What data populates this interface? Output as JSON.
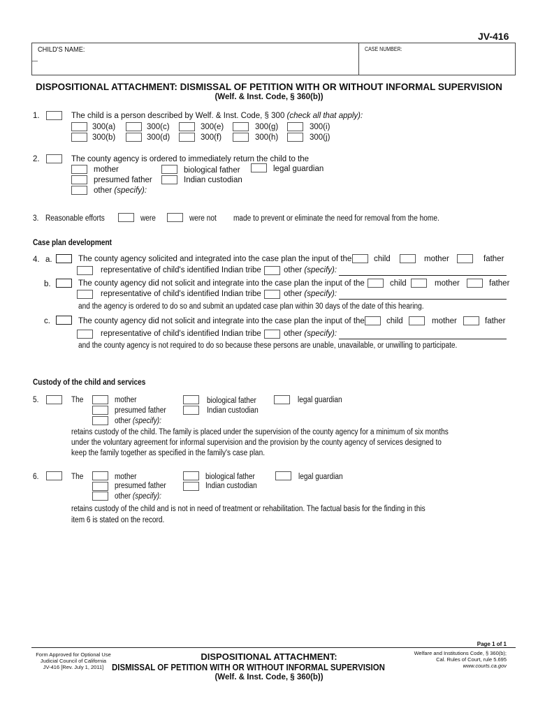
{
  "form": {
    "id": "JV-416",
    "header": {
      "childs_name_label": "CHILD'S NAME:",
      "childs_name_value": "",
      "case_number_label": "CASE NUMBER:",
      "case_number_value": ""
    },
    "title": "DISPOSITIONAL ATTACHMENT: DISMISSAL OF PETITION WITH OR WITHOUT INFORMAL SUPERVISION",
    "subtitle": "(Welf. & Inst. Code, § 360(b))"
  },
  "item1": {
    "number": "1.",
    "text": "The child is a person described by Welf. & Inst. Code, § 300",
    "text_italic": "(check all that apply):",
    "options": [
      "300(a)",
      "300(c)",
      "300(e)",
      "300(g)",
      "300(i)",
      "300(b)",
      "300(d)",
      "300(f)",
      "300(h)",
      "300(j)"
    ]
  },
  "item2": {
    "number": "2.",
    "text": "The county agency is ordered to immediately return the child to the",
    "options": {
      "mother": "mother",
      "biological_father": "biological father",
      "legal_guardian": "legal guardian",
      "presumed_father": "presumed father",
      "indian_custodian": "Indian custodian",
      "other": "other",
      "specify": "(specify):"
    }
  },
  "item3": {
    "number": "3.",
    "label": "Reasonable efforts",
    "were": "were",
    "were_not": "were not",
    "text": "made to prevent or eliminate the need for removal from the home."
  },
  "case_plan": {
    "heading": "Case plan development",
    "number": "4.",
    "a": {
      "letter": "a.",
      "text": "The county agency solicited and integrated into the case plan the input of the",
      "child": "child",
      "mother": "mother",
      "father": "father",
      "tribe": "representative of child's identified Indian tribe",
      "other": "other",
      "specify": "(specify):"
    },
    "b": {
      "letter": "b.",
      "text": "The county agency did not solicit and integrate into the case plan the input of the",
      "child": "child",
      "mother": "mother",
      "father": "father",
      "tribe": "representative of child's identified Indian tribe",
      "other": "other",
      "specify": "(specify):",
      "followup": "and  the agency is ordered to do so and submit an updated case plan within 30 days of the date of this hearing."
    },
    "c": {
      "letter": "c.",
      "text": "The county agency did not solicit and integrate into the case plan the input of the",
      "child": "child",
      "mother": "mother",
      "father": "father",
      "tribe": "representative of child's identified Indian tribe",
      "other": "other",
      "specify": "(specify):",
      "followup": "and the county agency is not required to do so because these persons are unable, unavailable, or unwilling to participate."
    }
  },
  "custody": {
    "heading": "Custody of the child and services",
    "item5": {
      "number": "5.",
      "the": "The",
      "mother": "mother",
      "biological_father": "biological father",
      "legal_guardian": "legal guardian",
      "presumed_father": "presumed father",
      "indian_custodian": "Indian custodian",
      "other": "other",
      "specify": "(specify):",
      "text_lines": [
        "retains custody of the child. The family is placed under the supervision of the county agency for a minimum of six months",
        "under the voluntary agreement for informal supervision and the provision by the county agency of services designed to",
        "keep the family together as specified in the family's case plan."
      ]
    },
    "item6": {
      "number": "6.",
      "the": "The",
      "mother": "mother",
      "biological_father": "biological father",
      "legal_guardian": "legal guardian",
      "presumed_father": "presumed father",
      "indian_custodian": "Indian custodian",
      "other": "other",
      "specify": "(specify):",
      "text_lines": [
        "retains custody of the child and is not in need of treatment or rehabilitation. The factual basis for the finding in this",
        "item 6 is stated on the record."
      ]
    }
  },
  "footer": {
    "page": "Page 1 of 1",
    "left_lines": [
      "Form Approved for Optional Use",
      "Judicial Council of California",
      "JV-416 [Rev. July 1, 2011]"
    ],
    "title_line1": "DISPOSITIONAL ATTACHMENT:",
    "title_line2": "DISMISSAL OF PETITION WITH OR WITHOUT INFORMAL SUPERVISION",
    "title_line3": "(Welf. & Inst. Code, § 360(b))",
    "right_lines": [
      "Welfare and Institutions Code, § 360(b);",
      "Cal. Rules of Court, rule 5.695",
      "www.courts.ca.gov"
    ]
  }
}
